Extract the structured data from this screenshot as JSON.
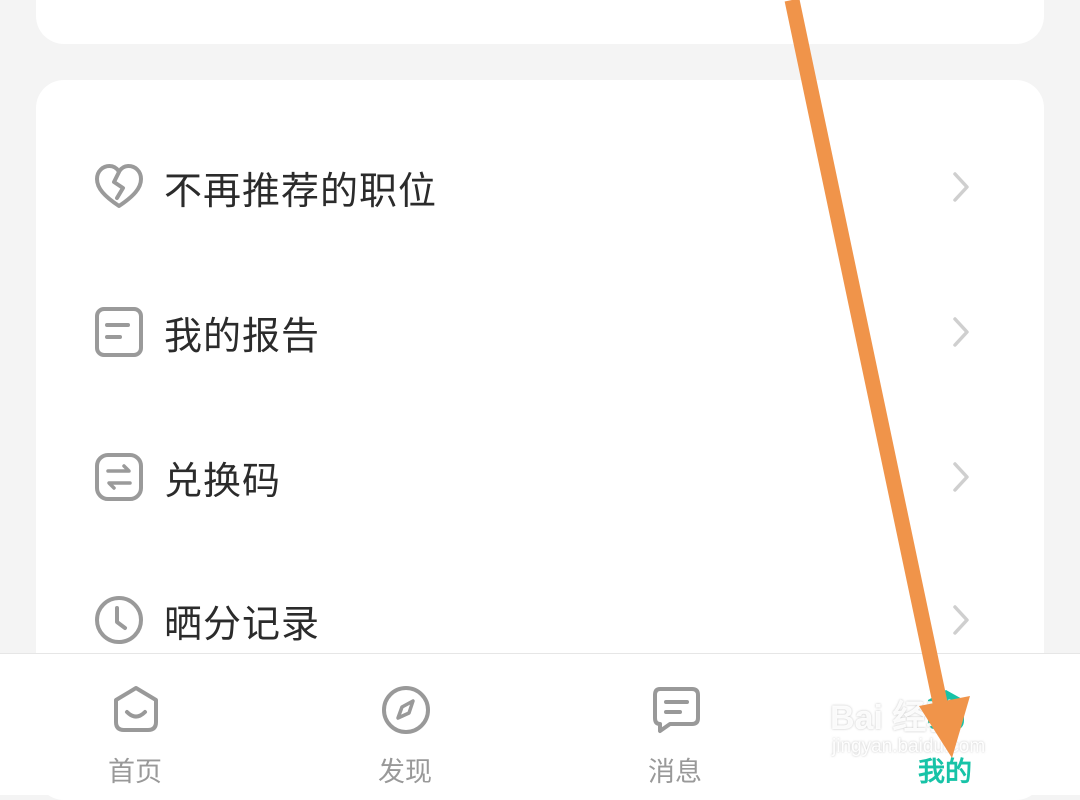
{
  "menu": {
    "items": [
      {
        "label": "不再推荐的职位",
        "icon": "broken-heart-icon"
      },
      {
        "label": "我的报告",
        "icon": "document-icon"
      },
      {
        "label": "兑换码",
        "icon": "swap-arrows-icon"
      },
      {
        "label": "晒分记录",
        "icon": "clock-icon"
      }
    ]
  },
  "tabbar": {
    "tabs": [
      {
        "label": "首页",
        "icon": "home-smile-icon",
        "active": false
      },
      {
        "label": "发现",
        "icon": "compass-icon",
        "active": false
      },
      {
        "label": "消息",
        "icon": "message-icon",
        "active": false
      },
      {
        "label": "我的",
        "icon": "profile-icon",
        "active": true
      }
    ]
  },
  "watermark": {
    "brand": "Bai 经验",
    "url": "jingyan.baidu.com"
  },
  "colors": {
    "accent": "#17c3a7",
    "annotation_arrow": "#f0944a",
    "text_primary": "#2b2b2b",
    "text_secondary": "#999999",
    "icon_stroke": "#9a9a9a"
  }
}
